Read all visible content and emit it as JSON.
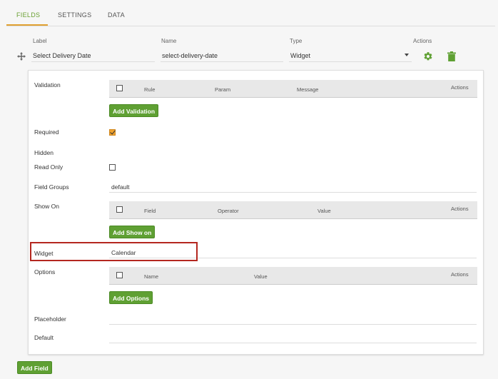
{
  "tabs": [
    {
      "label": "FIELDS",
      "active": true
    },
    {
      "label": "SETTINGS",
      "active": false
    },
    {
      "label": "DATA",
      "active": false
    }
  ],
  "columns": {
    "label": "Label",
    "name": "Name",
    "type": "Type",
    "actions": "Actions"
  },
  "field_row": {
    "label": "Select Delivery Date",
    "name": "select-delivery-date",
    "type": "Widget",
    "icons": [
      "drag-handle-icon",
      "gear-icon",
      "trash-icon"
    ]
  },
  "panel": {
    "validation": {
      "label": "Validation",
      "headers": {
        "rule": "Rule",
        "param": "Param",
        "message": "Message",
        "actions": "Actions"
      },
      "button": "Add Validation"
    },
    "required": {
      "label": "Required",
      "checked": true
    },
    "hidden": {
      "label": "Hidden"
    },
    "read_only": {
      "label": "Read Only",
      "checked": false
    },
    "field_groups": {
      "label": "Field Groups",
      "value": "default"
    },
    "show_on": {
      "label": "Show On",
      "headers": {
        "field": "Field",
        "operator": "Operator",
        "value": "Value",
        "actions": "Actions"
      },
      "button": "Add Show on"
    },
    "widget": {
      "label": "Widget",
      "value": "Calendar"
    },
    "options": {
      "label": "Options",
      "headers": {
        "name": "Name",
        "value": "Value",
        "actions": "Actions"
      },
      "button": "Add Options"
    },
    "placeholder": {
      "label": "Placeholder",
      "value": ""
    },
    "default": {
      "label": "Default",
      "value": ""
    }
  },
  "add_field_button": "Add Field",
  "colors": {
    "accent": "#5fa033",
    "tab_underline": "#e0a030",
    "highlight": "#b4271f",
    "checkbox": "#f0a22e"
  }
}
